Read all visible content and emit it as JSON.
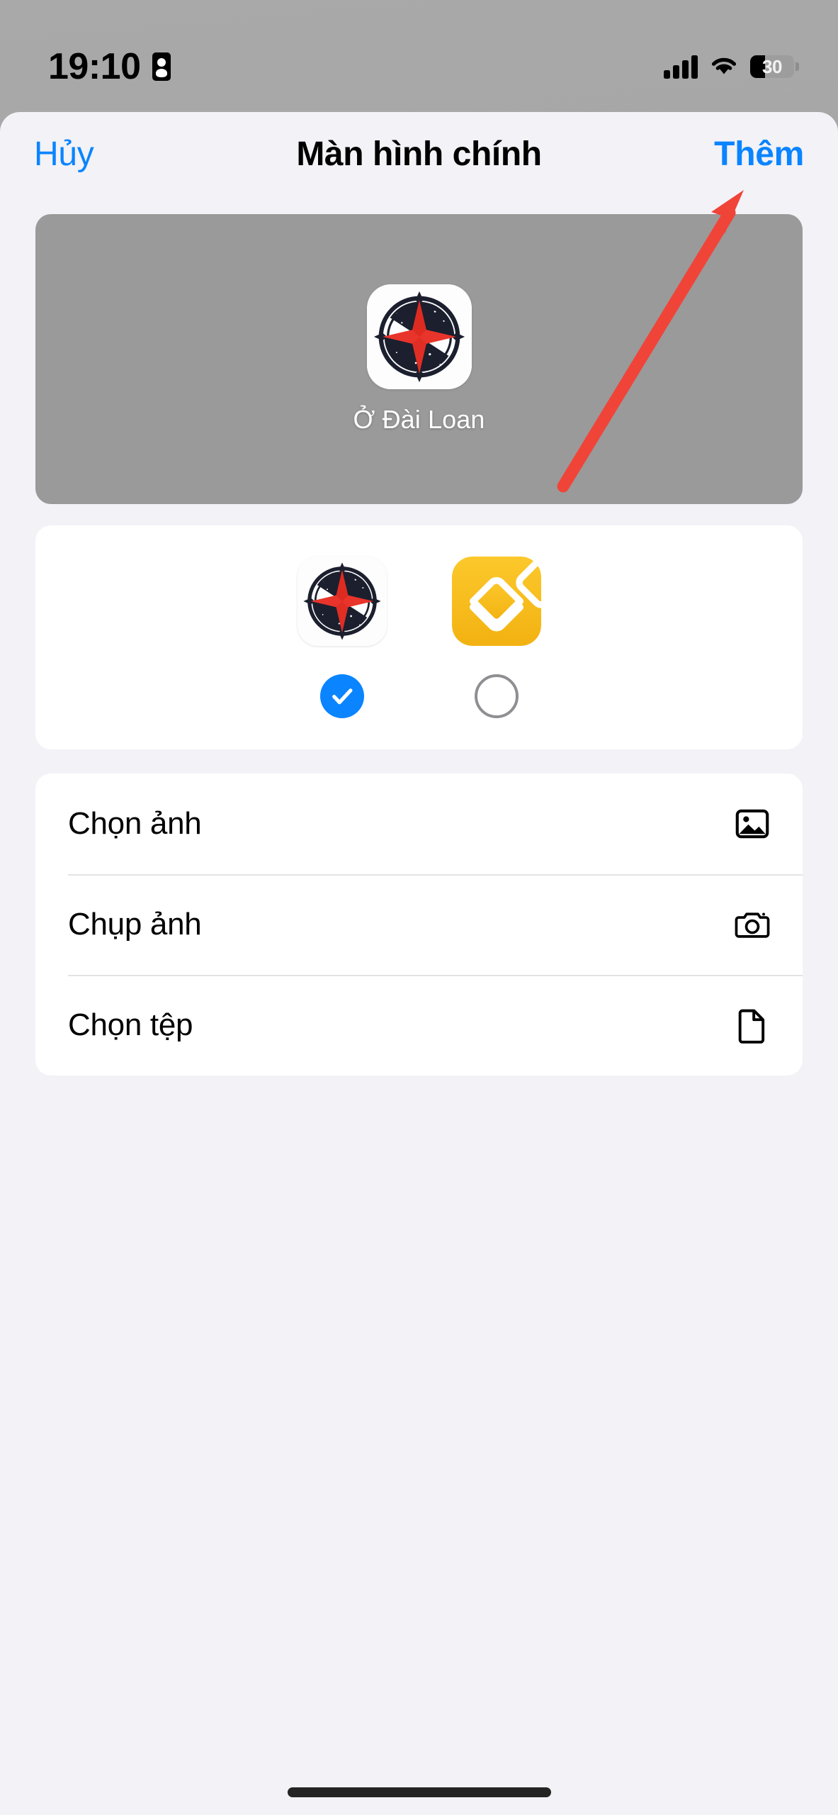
{
  "status_bar": {
    "time": "19:10",
    "record_icon": "screen-record-icon",
    "signal_icon": "cellular-signal-icon",
    "wifi_icon": "wifi-icon",
    "battery_percent": "30",
    "battery_icon": "battery-icon"
  },
  "nav": {
    "cancel_label": "Hủy",
    "title": "Màn hình chính",
    "add_label": "Thêm"
  },
  "preview": {
    "app_label": "Ở Đài Loan",
    "icon_name": "compass-app-icon"
  },
  "icon_chooser": {
    "options": [
      {
        "icon_name": "compass-app-icon",
        "selected": true
      },
      {
        "icon_name": "layers-stack-icon",
        "selected": false
      }
    ]
  },
  "options_list": [
    {
      "label": "Chọn ảnh",
      "icon": "photo-icon"
    },
    {
      "label": "Chụp ảnh",
      "icon": "camera-icon"
    },
    {
      "label": "Chọn tệp",
      "icon": "document-icon"
    }
  ],
  "annotation": {
    "type": "arrow",
    "color": "#f04438",
    "points_to": "Thêm"
  },
  "colors": {
    "accent_blue": "#0a84ff",
    "sheet_background": "#f2f2f7",
    "card_white": "#ffffff",
    "preview_gray": "#9a9a9a",
    "layers_yellow": "#f7bc20",
    "compass_red": "#e8342a",
    "compass_navy": "#1b1f2e",
    "annotation_red": "#f04438"
  }
}
